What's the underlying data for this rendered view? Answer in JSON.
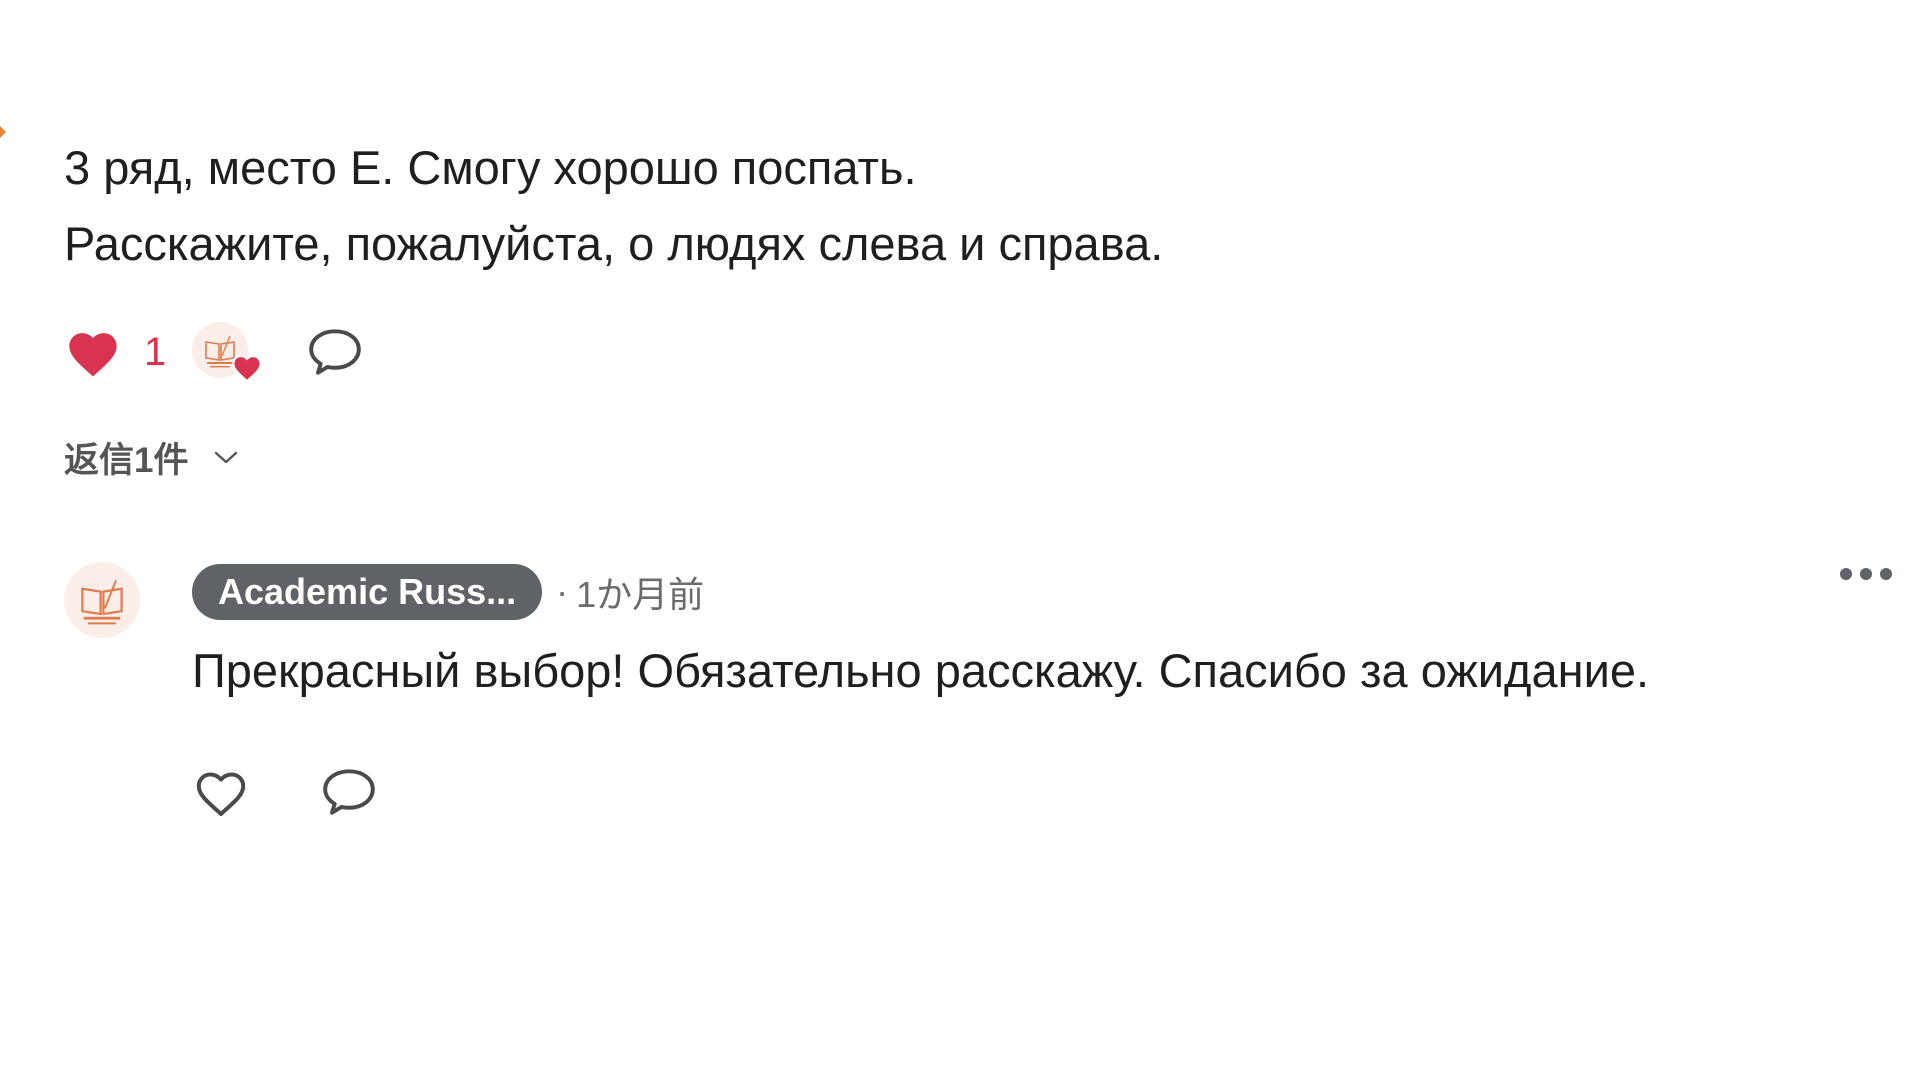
{
  "comment": {
    "lines": [
      "3 ряд, место Е. Смогу хорошо поспать.",
      "Расскажите, пожалуйста, о людях слева и справа."
    ],
    "like_count": "1",
    "replies_toggle": "返信1件"
  },
  "reply": {
    "author": "Academic Russ...",
    "separator": "·",
    "time": "1か月前",
    "text": "Прекрасный выбор! Обязательно расскажу. Спасибо за ожидание."
  },
  "colors": {
    "like_red": "#d9344f",
    "author_pill": "#5f6368",
    "logo_orange": "#e07a4f"
  },
  "icons": {
    "liked": "filled-heart-icon",
    "comment": "speech-bubble-icon",
    "like": "outline-heart-icon",
    "more": "ellipsis-icon",
    "expand": "chevron-down-icon"
  }
}
